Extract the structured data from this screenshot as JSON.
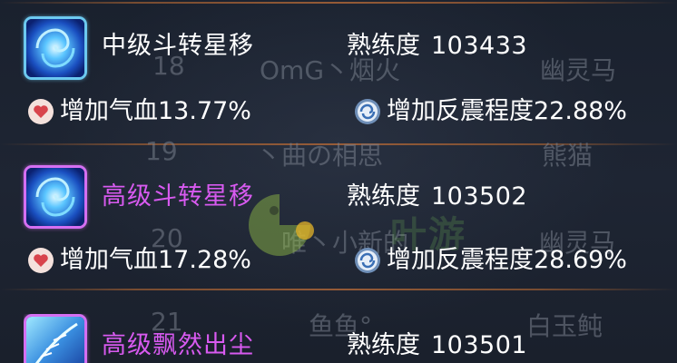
{
  "skills": [
    {
      "name": "中级斗转星移",
      "name_color": "#ffffff",
      "frame": "blue",
      "proficiency_label": "熟练度",
      "proficiency_value": "103433",
      "effects": [
        {
          "icon": "heart-icon",
          "label": "增加气血",
          "value": "13.77%"
        },
        {
          "icon": "swirl-icon",
          "label": "增加反震程度",
          "value": "22.88%"
        }
      ]
    },
    {
      "name": "高级斗转星移",
      "name_color": "#d85af0",
      "frame": "purple",
      "proficiency_label": "熟练度",
      "proficiency_value": "103502",
      "effects": [
        {
          "icon": "heart-icon",
          "label": "增加气血",
          "value": "17.28%"
        },
        {
          "icon": "swirl-icon",
          "label": "增加反震程度",
          "value": "28.69%"
        }
      ]
    },
    {
      "name": "高级飘然出尘",
      "name_color": "#d85af0",
      "frame": "purple",
      "proficiency_label": "熟练度",
      "proficiency_value": "103501",
      "effects": []
    }
  ],
  "background_table": {
    "rows": [
      {
        "rank": "18",
        "name": "OmG丶烟火",
        "pet": "幽灵马"
      },
      {
        "rank": "19",
        "name": "丶曲の相思",
        "pet": "熊猫"
      },
      {
        "rank": "20",
        "name": "唯丶小新的",
        "pet": "幽灵马"
      },
      {
        "rank": "21",
        "name": "鱼鱼°",
        "pet": "白玉鲀"
      }
    ]
  },
  "watermark": {
    "text": "叶游"
  },
  "colors": {
    "background": "#1b2230",
    "divider": "#a8643a",
    "purple_name": "#d85af0",
    "blue_frame": "#6cc9f0",
    "purple_frame": "#d56ff2"
  }
}
